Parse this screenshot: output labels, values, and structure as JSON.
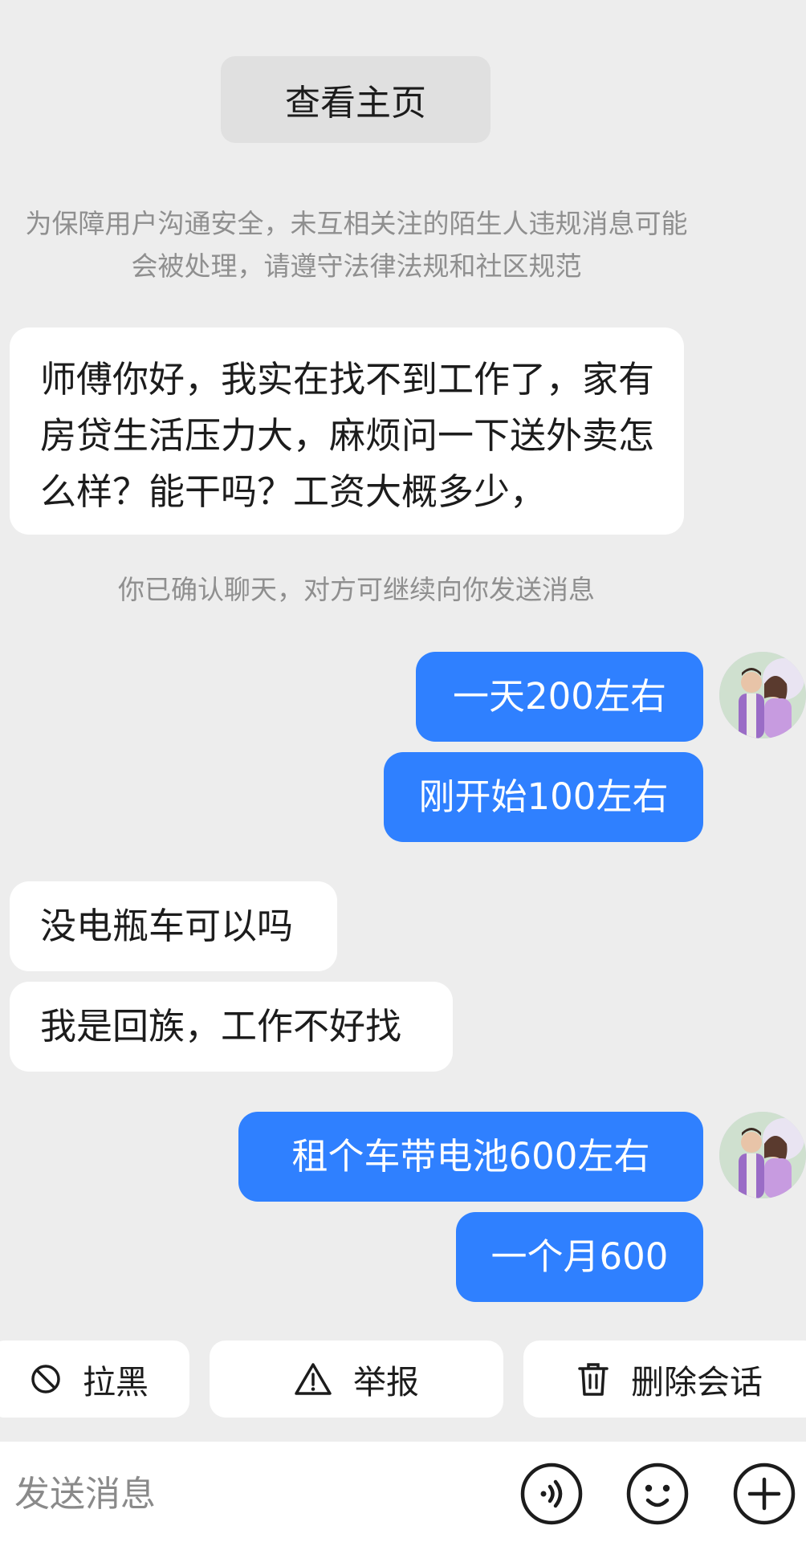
{
  "header": {
    "view_profile_label": "查看主页"
  },
  "notice": {
    "line1": "为保障用户沟通安全，未互相关注的陌生人违规消息可能",
    "line2": "会被处理，请遵守法律法规和社区规范"
  },
  "messages": [
    {
      "side": "incoming",
      "text": "师傅你好，我实在找不到工作了，家有房贷生活压力大，麻烦问一下送外卖怎么样？能干吗？工资大概多少，"
    },
    {
      "side": "system",
      "text": "你已确认聊天，对方可继续向你发送消息"
    },
    {
      "side": "outgoing",
      "text": "一天200左右"
    },
    {
      "side": "outgoing",
      "text": "刚开始100左右"
    },
    {
      "side": "incoming",
      "text": "没电瓶车可以吗"
    },
    {
      "side": "incoming",
      "text": "我是回族，工作不好找"
    },
    {
      "side": "outgoing",
      "text": "租个车带电池600左右"
    },
    {
      "side": "outgoing",
      "text": "一个月600"
    }
  ],
  "actions": {
    "block": {
      "label": "拉黑",
      "icon": "block-icon"
    },
    "report": {
      "label": "举报",
      "icon": "warning-icon"
    },
    "delete": {
      "label": "删除会话",
      "icon": "trash-icon"
    }
  },
  "composer": {
    "placeholder": "发送消息",
    "voice_icon": "voice-icon",
    "emoji_icon": "emoji-icon",
    "plus_icon": "plus-icon"
  },
  "colors": {
    "background": "#ededed",
    "outgoing_bubble": "#2f80ff",
    "incoming_bubble": "#ffffff",
    "system_text": "#8f8f8f"
  }
}
